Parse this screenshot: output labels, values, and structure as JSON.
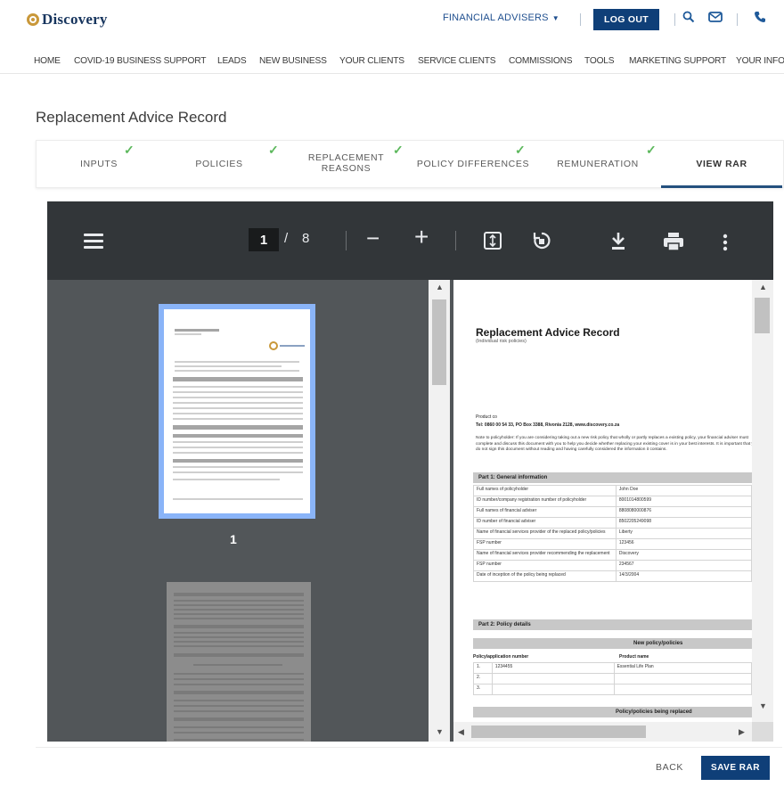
{
  "header": {
    "brand": "Discovery",
    "advisers_menu": "FINANCIAL ADVISERS",
    "logout": "LOG OUT",
    "icons": [
      "search-icon",
      "mail-icon",
      "phone-icon"
    ]
  },
  "nav": {
    "items": [
      "HOME",
      "COVID-19 BUSINESS SUPPORT",
      "LEADS",
      "NEW BUSINESS",
      "YOUR CLIENTS",
      "SERVICE CLIENTS",
      "COMMISSIONS",
      "TOOLS",
      "MARKETING SUPPORT",
      "YOUR INFO"
    ]
  },
  "page": {
    "title": "Replacement Advice Record"
  },
  "steps": [
    {
      "label": "INPUTS",
      "done": true
    },
    {
      "label": "POLICIES",
      "done": true
    },
    {
      "label": "REPLACEMENT",
      "label2": "REASONS",
      "done": true
    },
    {
      "label": "POLICY DIFFERENCES",
      "done": true
    },
    {
      "label": "REMUNERATION",
      "done": true
    },
    {
      "label": "VIEW RAR",
      "active": true
    }
  ],
  "viewer": {
    "current_page": "1",
    "separator": "/",
    "total_pages": "8",
    "zoom_out": "−",
    "zoom_in": "+",
    "thumb_label": "1"
  },
  "document": {
    "title": "Replacement Advice Record",
    "subtitle": "(Individual risk policies)",
    "product_line": "Product co",
    "contact": "Tel: 0860 00 54 33, PO Box 3388, Rivonia 2128, www.discovery.co.za",
    "note": "Note to policyholder: If you are considering taking out a new risk policy that wholly or partly replaces a existing policy, your financial adviser must complete and discuss this document with you to help you decide whether replacing your existing cover is in your best interests. It is important that you do not sign this document without reading and having carefully considered the information it contains.",
    "part1": "Part 1: General information",
    "part1_rows": [
      [
        "Full names of policyholder",
        "John Doe"
      ],
      [
        "ID number/company registration number of policyholder",
        "8001014800599"
      ],
      [
        "Full names of financial adviser",
        "8808080000876"
      ],
      [
        "ID number of financial adviser",
        "8502205249098"
      ],
      [
        "Name of financial services provider of the replaced policy/policies",
        "Liberty"
      ],
      [
        "FSP number",
        "123456"
      ],
      [
        "Name of financial services provider recommending the replacement",
        "Discovery"
      ],
      [
        "FSP number",
        "234567"
      ],
      [
        "Date of inception of the policy being replaced",
        "14/3/2004"
      ]
    ],
    "part2": "Part 2: Policy details",
    "new_policies": "New policy/policies",
    "col_number": "Policy/application number",
    "col_product": "Product name",
    "rows": [
      [
        "1.",
        "1234455",
        "Essential Life Plan"
      ],
      [
        "2.",
        "",
        ""
      ],
      [
        "3.",
        "",
        ""
      ]
    ],
    "replaced": "Policy/policies being replaced"
  },
  "footer": {
    "back": "BACK",
    "save": "SAVE RAR"
  }
}
